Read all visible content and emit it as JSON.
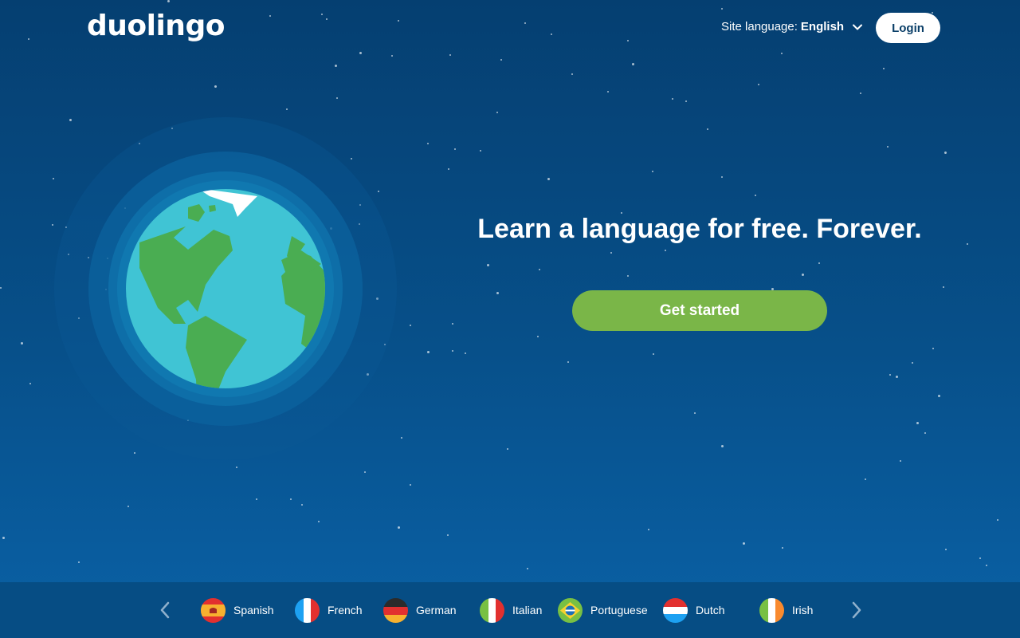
{
  "header": {
    "logo": "duolingo",
    "site_language_label": "Site language:",
    "site_language_value": "English",
    "login_label": "Login"
  },
  "hero": {
    "title": "Learn a language for free. Forever.",
    "cta_label": "Get started"
  },
  "language_bar": {
    "prev_icon": "chevron-left-icon",
    "next_icon": "chevron-right-icon",
    "languages": [
      {
        "label": "Spanish",
        "flag": "spain-flag-icon"
      },
      {
        "label": "French",
        "flag": "france-flag-icon"
      },
      {
        "label": "German",
        "flag": "germany-flag-icon"
      },
      {
        "label": "Italian",
        "flag": "italy-flag-icon"
      },
      {
        "label": "Portuguese",
        "flag": "brazil-flag-icon"
      },
      {
        "label": "Dutch",
        "flag": "netherlands-flag-icon"
      },
      {
        "label": "Irish",
        "flag": "ireland-flag-icon"
      }
    ]
  },
  "colors": {
    "background_top": "#053f71",
    "background_bottom": "#0a61a6",
    "cta_green": "#7ab648",
    "ocean": "#40c4d4",
    "land": "#4aad52"
  }
}
